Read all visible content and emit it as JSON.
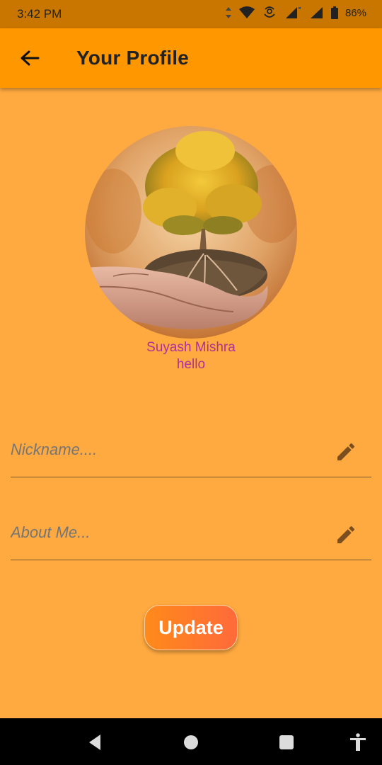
{
  "status_bar": {
    "time": "3:42 PM",
    "battery": "86%",
    "icons": [
      "data-arrows-icon",
      "wifi-icon",
      "hotspot-icon",
      "signal-icon",
      "signal-icon",
      "battery-icon"
    ]
  },
  "app_bar": {
    "title": "Your Profile",
    "back_icon": "arrow-back-icon"
  },
  "profile": {
    "avatar": "tree-in-hands-photo",
    "name": "Suyash Mishra",
    "about": "hello"
  },
  "form": {
    "nickname_placeholder": "Nickname....",
    "about_placeholder": "About Me...",
    "edit_icon": "pencil-icon",
    "update_label": "Update"
  },
  "nav_bar": {
    "items": [
      "back-triangle-icon",
      "home-circle-icon",
      "recents-square-icon",
      "accessibility-icon"
    ]
  },
  "colors": {
    "background": "#FFAA40",
    "app_bar": "#FF9800",
    "status_bar": "#C87600",
    "name_text": "#B0309A",
    "nickname_text": "#A52A9F",
    "about_text": "#4CAF50",
    "update_gradient_start": "#FF8A1A",
    "update_gradient_end": "#FF6A3A"
  }
}
